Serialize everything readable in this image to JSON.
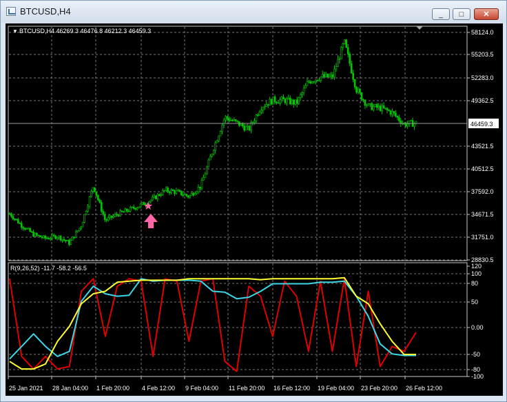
{
  "window": {
    "title": "BTCUSD,H4",
    "minimize_glyph": "_",
    "maximize_glyph": "□",
    "close_glyph": "✕"
  },
  "price_panel": {
    "symbol_info": "BTCUSD,H4  46269.3 46476.8 46212.3 46459.3",
    "price_ticks": [
      "58124.0",
      "55203.5",
      "52283.0",
      "49362.5",
      "46459.3",
      "43521.5",
      "40512.5",
      "37592.0",
      "34671.5",
      "31751.0",
      "28830.5"
    ],
    "current_price": "46459.3",
    "candle_color": "#00c800",
    "marker": {
      "icon": "star-icon",
      "arrow": "up-arrow-icon",
      "color": "#ff66a8"
    }
  },
  "indicator_panel": {
    "label": "R(9,26,52) -11.7 -58.2 -56.5",
    "ticks": [
      "120",
      "100",
      "80",
      "50",
      "0.00",
      "-50",
      "-80",
      "-100"
    ],
    "series_colors": {
      "fast": "#e00000",
      "mid": "#3cd8e8",
      "slow": "#ffff33"
    }
  },
  "time_axis": [
    "25 Jan 2021",
    "28 Jan 04:00",
    "1 Feb 20:00",
    "4 Feb 12:00",
    "9 Feb 04:00",
    "11 Feb 20:00",
    "16 Feb 12:00",
    "19 Feb 04:00",
    "23 Feb 20:00",
    "26 Feb 12:00"
  ],
  "chart_data": {
    "type": "line",
    "title": "BTCUSD,H4",
    "price_close": [
      34800,
      33300,
      32100,
      31600,
      31900,
      31000,
      33300,
      38400,
      33900,
      34700,
      35300,
      35900,
      36700,
      37800,
      37600,
      37000,
      38400,
      43000,
      47200,
      46500,
      45600,
      48500,
      49400,
      49400,
      49000,
      51800,
      52400,
      52400,
      56900,
      50800,
      48600,
      48400,
      47800,
      46300,
      46460
    ],
    "indicator": {
      "ylim": [
        -100,
        120
      ],
      "series": [
        {
          "values": [
            95,
            -60,
            -85,
            -60,
            -85,
            -80,
            70,
            95,
            -20,
            80,
            95,
            90,
            -60,
            95,
            90,
            -30,
            90,
            95,
            -70,
            -90,
            80,
            60,
            -20,
            90,
            60,
            -50,
            90,
            -50,
            95,
            -80,
            70,
            -80,
            -40,
            -50,
            -12
          ]
        },
        {
          "values": [
            -65,
            -40,
            -15,
            -40,
            -60,
            -50,
            50,
            80,
            65,
            60,
            62,
            95,
            90,
            92,
            92,
            92,
            90,
            70,
            68,
            55,
            58,
            70,
            85,
            85,
            85,
            85,
            88,
            88,
            90,
            60,
            20,
            -35,
            -55,
            -58,
            -58
          ]
        },
        {
          "values": [
            -70,
            -85,
            -85,
            -75,
            -30,
            0,
            45,
            65,
            70,
            88,
            90,
            92,
            92,
            92,
            92,
            95,
            95,
            95,
            95,
            95,
            95,
            93,
            95,
            95,
            95,
            95,
            95,
            95,
            97,
            60,
            45,
            5,
            -30,
            -56,
            -56
          ]
        }
      ]
    }
  }
}
